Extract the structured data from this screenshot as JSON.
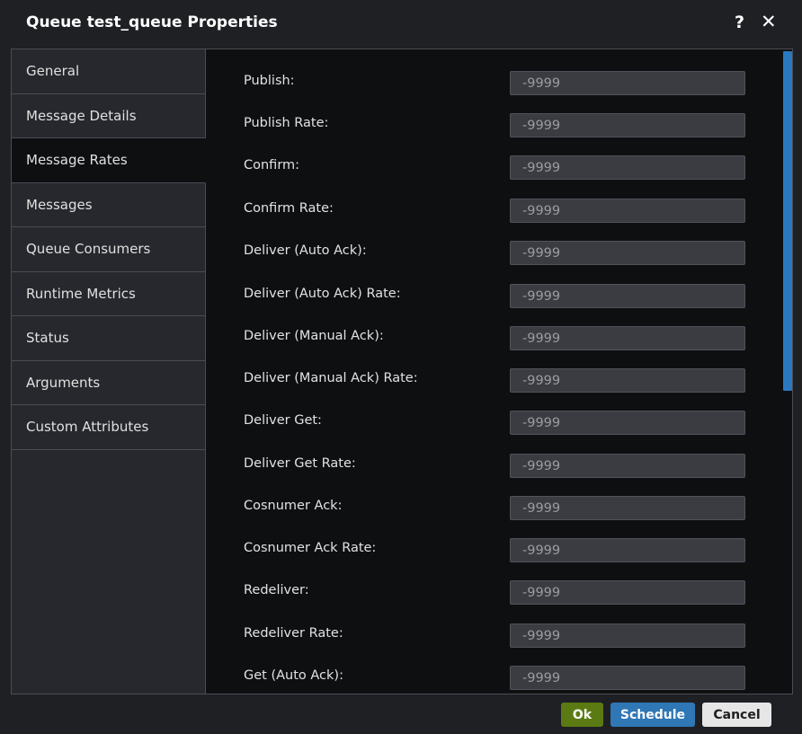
{
  "dialog": {
    "title": "Queue test_queue Properties",
    "help_symbol": "?",
    "close_symbol": "✕"
  },
  "sidebar": {
    "items": [
      {
        "label": "General",
        "active": false
      },
      {
        "label": "Message Details",
        "active": false
      },
      {
        "label": "Message Rates",
        "active": true
      },
      {
        "label": "Messages",
        "active": false
      },
      {
        "label": "Queue Consumers",
        "active": false
      },
      {
        "label": "Runtime Metrics",
        "active": false
      },
      {
        "label": "Status",
        "active": false
      },
      {
        "label": "Arguments",
        "active": false
      },
      {
        "label": "Custom Attributes",
        "active": false
      }
    ]
  },
  "fields": [
    {
      "label": "Publish:",
      "value": "-9999"
    },
    {
      "label": "Publish Rate:",
      "value": "-9999"
    },
    {
      "label": "Confirm:",
      "value": "-9999"
    },
    {
      "label": "Confirm Rate:",
      "value": "-9999"
    },
    {
      "label": "Deliver (Auto Ack):",
      "value": "-9999"
    },
    {
      "label": "Deliver (Auto Ack) Rate:",
      "value": "-9999"
    },
    {
      "label": "Deliver (Manual Ack):",
      "value": "-9999"
    },
    {
      "label": "Deliver (Manual Ack) Rate:",
      "value": "-9999"
    },
    {
      "label": "Deliver Get:",
      "value": "-9999"
    },
    {
      "label": "Deliver Get Rate:",
      "value": "-9999"
    },
    {
      "label": "Cosnumer Ack:",
      "value": "-9999"
    },
    {
      "label": "Cosnumer Ack Rate:",
      "value": "-9999"
    },
    {
      "label": "Redeliver:",
      "value": "-9999"
    },
    {
      "label": "Redeliver Rate:",
      "value": "-9999"
    },
    {
      "label": "Get (Auto Ack):",
      "value": "-9999"
    }
  ],
  "footer": {
    "ok_label": "Ok",
    "schedule_label": "Schedule",
    "cancel_label": "Cancel"
  },
  "colors": {
    "ok": "#5c7a13",
    "schedule": "#2f77b5",
    "scroll_thumb": "#2a78c0"
  }
}
